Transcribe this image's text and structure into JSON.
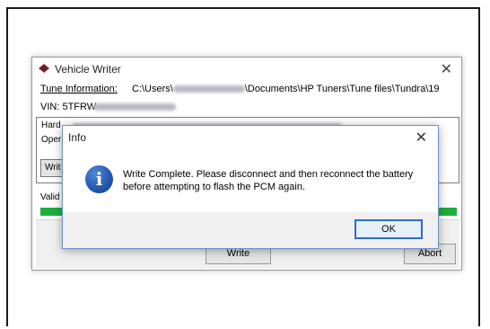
{
  "vehicle_writer": {
    "title": "Vehicle Writer",
    "close_glyph": "✕",
    "tune_label": "Tune Information:",
    "tune_path_start": "C:\\Users\\",
    "tune_path_end": "\\Documents\\HP Tuners\\Tune files\\Tundra\\19",
    "vin_label": "VIN: 5TFRW",
    "hard_label": "Hard",
    "oper_label": "Oper",
    "small_button_label": "Writ",
    "valid_label": "Valid",
    "write_button": "Write",
    "abort_button": "Abort",
    "progress_fraction": 1.0,
    "progress_color": "#1fae3d"
  },
  "info_dialog": {
    "title": "Info",
    "close_glyph": "✕",
    "icon": "information-icon",
    "icon_glyph": "i",
    "message": "Write Complete. Please disconnect and then reconnect the battery before attempting to flash the PCM again.",
    "ok_button": "OK",
    "accent_color": "#2b6cd1"
  }
}
